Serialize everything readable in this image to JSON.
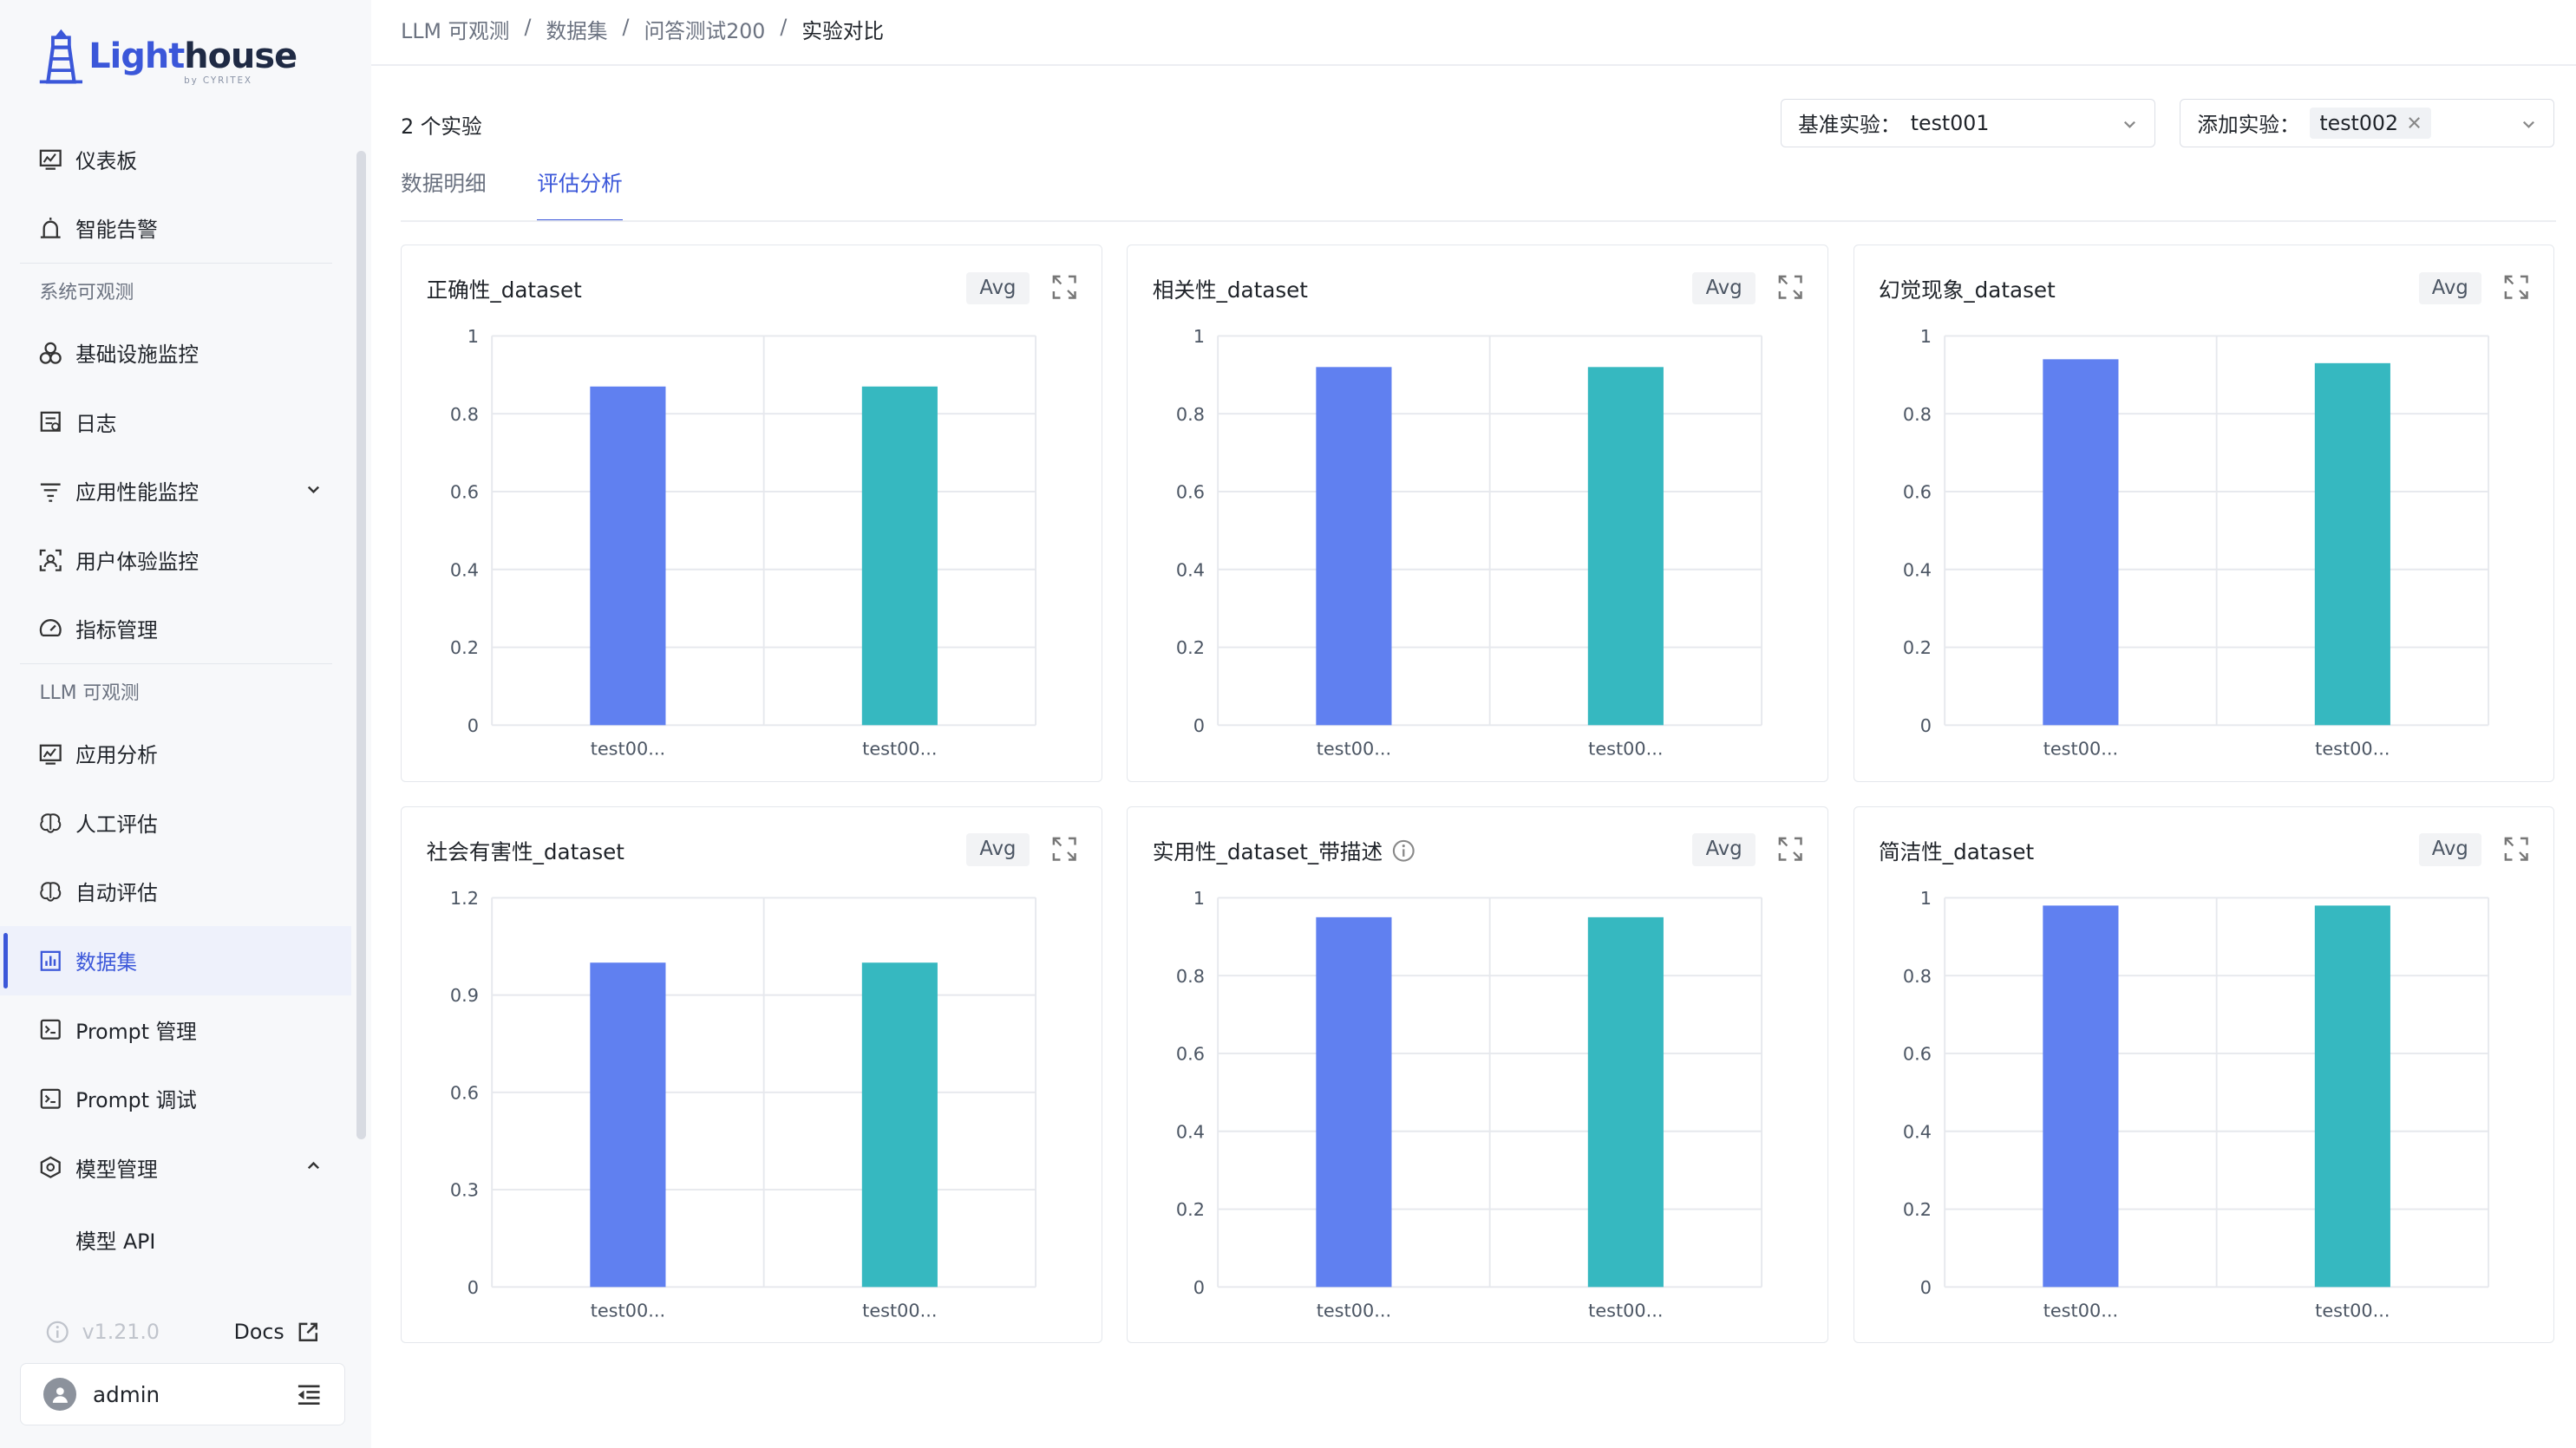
{
  "brand": {
    "name_part1": "Light",
    "name_part2": "house",
    "sub": "by CYRITEX"
  },
  "sidebar": {
    "items_top": [
      {
        "label": "仪表板",
        "icon": "dashboard-icon"
      },
      {
        "label": "智能告警",
        "icon": "alarm-icon"
      }
    ],
    "group1": "系统可观测",
    "items_sys": [
      {
        "label": "基础设施监控",
        "icon": "infra-icon"
      },
      {
        "label": "日志",
        "icon": "log-icon"
      },
      {
        "label": "应用性能监控",
        "icon": "apm-icon"
      },
      {
        "label": "用户体验监控",
        "icon": "rum-icon"
      },
      {
        "label": "指标管理",
        "icon": "metric-icon"
      }
    ],
    "group2": "LLM 可观测",
    "items_llm": [
      {
        "label": "应用分析",
        "icon": "app-analysis-icon"
      },
      {
        "label": "人工评估",
        "icon": "brain-icon"
      },
      {
        "label": "自动评估",
        "icon": "brain-icon"
      },
      {
        "label": "数据集",
        "icon": "dataset-icon"
      },
      {
        "label": "Prompt 管理",
        "icon": "prompt-icon"
      },
      {
        "label": "Prompt 调试",
        "icon": "prompt-icon"
      },
      {
        "label": "模型管理",
        "icon": "model-icon"
      }
    ],
    "sub_items": [
      "模型 API"
    ],
    "version": "v1.21.0",
    "docs": "Docs",
    "user": "admin"
  },
  "breadcrumb": [
    "LLM 可观测",
    "/",
    "数据集",
    "/",
    "问答测试200",
    "/",
    "实验对比"
  ],
  "header": {
    "count": "2 个实验",
    "base_label": "基准实验：",
    "base_value": "test001",
    "add_label": "添加实验：",
    "add_tag": "test002"
  },
  "tabs": [
    "数据明细",
    "评估分析"
  ],
  "avg_label": "Avg",
  "colors": {
    "series1": "#6080f0",
    "series2": "#36b8c0",
    "accent": "#3b57d9"
  },
  "chart_data": [
    {
      "type": "bar",
      "title": "正确性_dataset",
      "categories": [
        "test00...",
        "test00..."
      ],
      "values": [
        0.87,
        0.87
      ],
      "ylim": [
        0,
        1
      ],
      "yticks": [
        "0",
        "0.2",
        "0.4",
        "0.6",
        "0.8",
        "1"
      ],
      "ytick_values": [
        0,
        0.2,
        0.4,
        0.6,
        0.8,
        1
      ]
    },
    {
      "type": "bar",
      "title": "相关性_dataset",
      "categories": [
        "test00...",
        "test00..."
      ],
      "values": [
        0.92,
        0.92
      ],
      "ylim": [
        0,
        1
      ],
      "yticks": [
        "0",
        "0.2",
        "0.4",
        "0.6",
        "0.8",
        "1"
      ],
      "ytick_values": [
        0,
        0.2,
        0.4,
        0.6,
        0.8,
        1
      ]
    },
    {
      "type": "bar",
      "title": "幻觉现象_dataset",
      "categories": [
        "test00...",
        "test00..."
      ],
      "values": [
        0.94,
        0.93
      ],
      "ylim": [
        0,
        1
      ],
      "yticks": [
        "0",
        "0.2",
        "0.4",
        "0.6",
        "0.8",
        "1"
      ],
      "ytick_values": [
        0,
        0.2,
        0.4,
        0.6,
        0.8,
        1
      ]
    },
    {
      "type": "bar",
      "title": "社会有害性_dataset",
      "categories": [
        "test00...",
        "test00..."
      ],
      "values": [
        1,
        1
      ],
      "ylim": [
        0,
        1.2
      ],
      "yticks": [
        "0",
        "0.3",
        "0.6",
        "0.9",
        "1.2"
      ],
      "ytick_values": [
        0,
        0.3,
        0.6,
        0.9,
        1.2
      ]
    },
    {
      "type": "bar",
      "title": "实用性_dataset_带描述",
      "categories": [
        "test00...",
        "test00..."
      ],
      "values": [
        0.95,
        0.95
      ],
      "ylim": [
        0,
        1
      ],
      "yticks": [
        "0",
        "0.2",
        "0.4",
        "0.6",
        "0.8",
        "1"
      ],
      "ytick_values": [
        0,
        0.2,
        0.4,
        0.6,
        0.8,
        1
      ],
      "info": true
    },
    {
      "type": "bar",
      "title": "简洁性_dataset",
      "categories": [
        "test00...",
        "test00..."
      ],
      "values": [
        0.98,
        0.98
      ],
      "ylim": [
        0,
        1
      ],
      "yticks": [
        "0",
        "0.2",
        "0.4",
        "0.6",
        "0.8",
        "1"
      ],
      "ytick_values": [
        0,
        0.2,
        0.4,
        0.6,
        0.8,
        1
      ]
    }
  ]
}
